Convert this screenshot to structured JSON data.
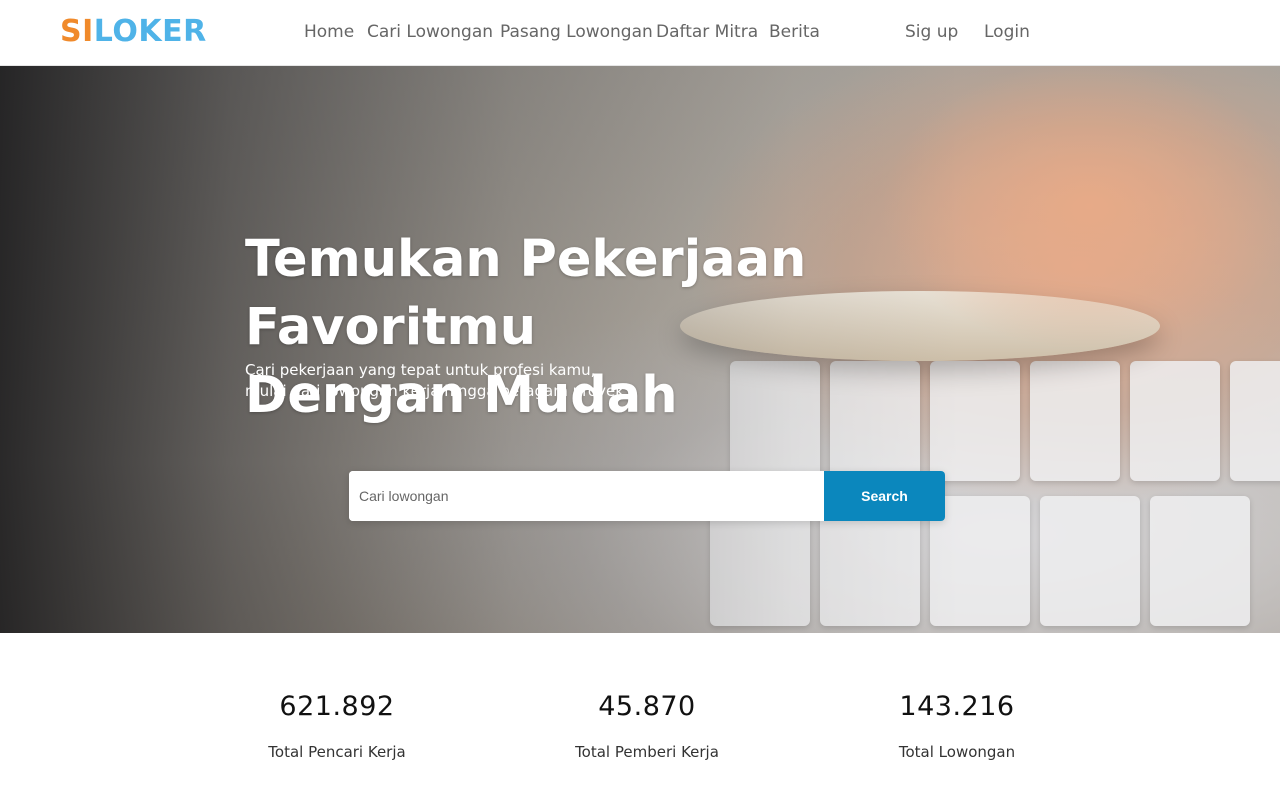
{
  "brand": {
    "part1": "SI",
    "part2": "LOKER"
  },
  "nav": {
    "home": "Home",
    "cari_lowongan": "Cari Lowongan",
    "pasang_lowongan": "Pasang Lowongan",
    "daftar_mitra": "Daftar Mitra",
    "berita": "Berita",
    "signup": "Sig up",
    "login": "Login"
  },
  "hero": {
    "title_line1": "Temukan Pekerjaan Favoritmu",
    "title_line2": "Dengan Mudah",
    "subtitle_line1": "Cari pekerjaan yang tepat untuk profesi kamu,",
    "subtitle_line2": "mulai dari lowongan kerja hingga beragam proyek."
  },
  "search": {
    "placeholder": "Cari lowongan",
    "value": "",
    "button_label": "Search"
  },
  "stats": [
    {
      "value": "621.892",
      "label": "Total Pencari Kerja"
    },
    {
      "value": "45.870",
      "label": "Total Pemberi Kerja"
    },
    {
      "value": "143.216",
      "label": "Total Lowongan"
    }
  ],
  "colors": {
    "brand_orange": "#f08a2b",
    "brand_blue": "#4fb3e8",
    "search_button": "#0b87bd"
  }
}
